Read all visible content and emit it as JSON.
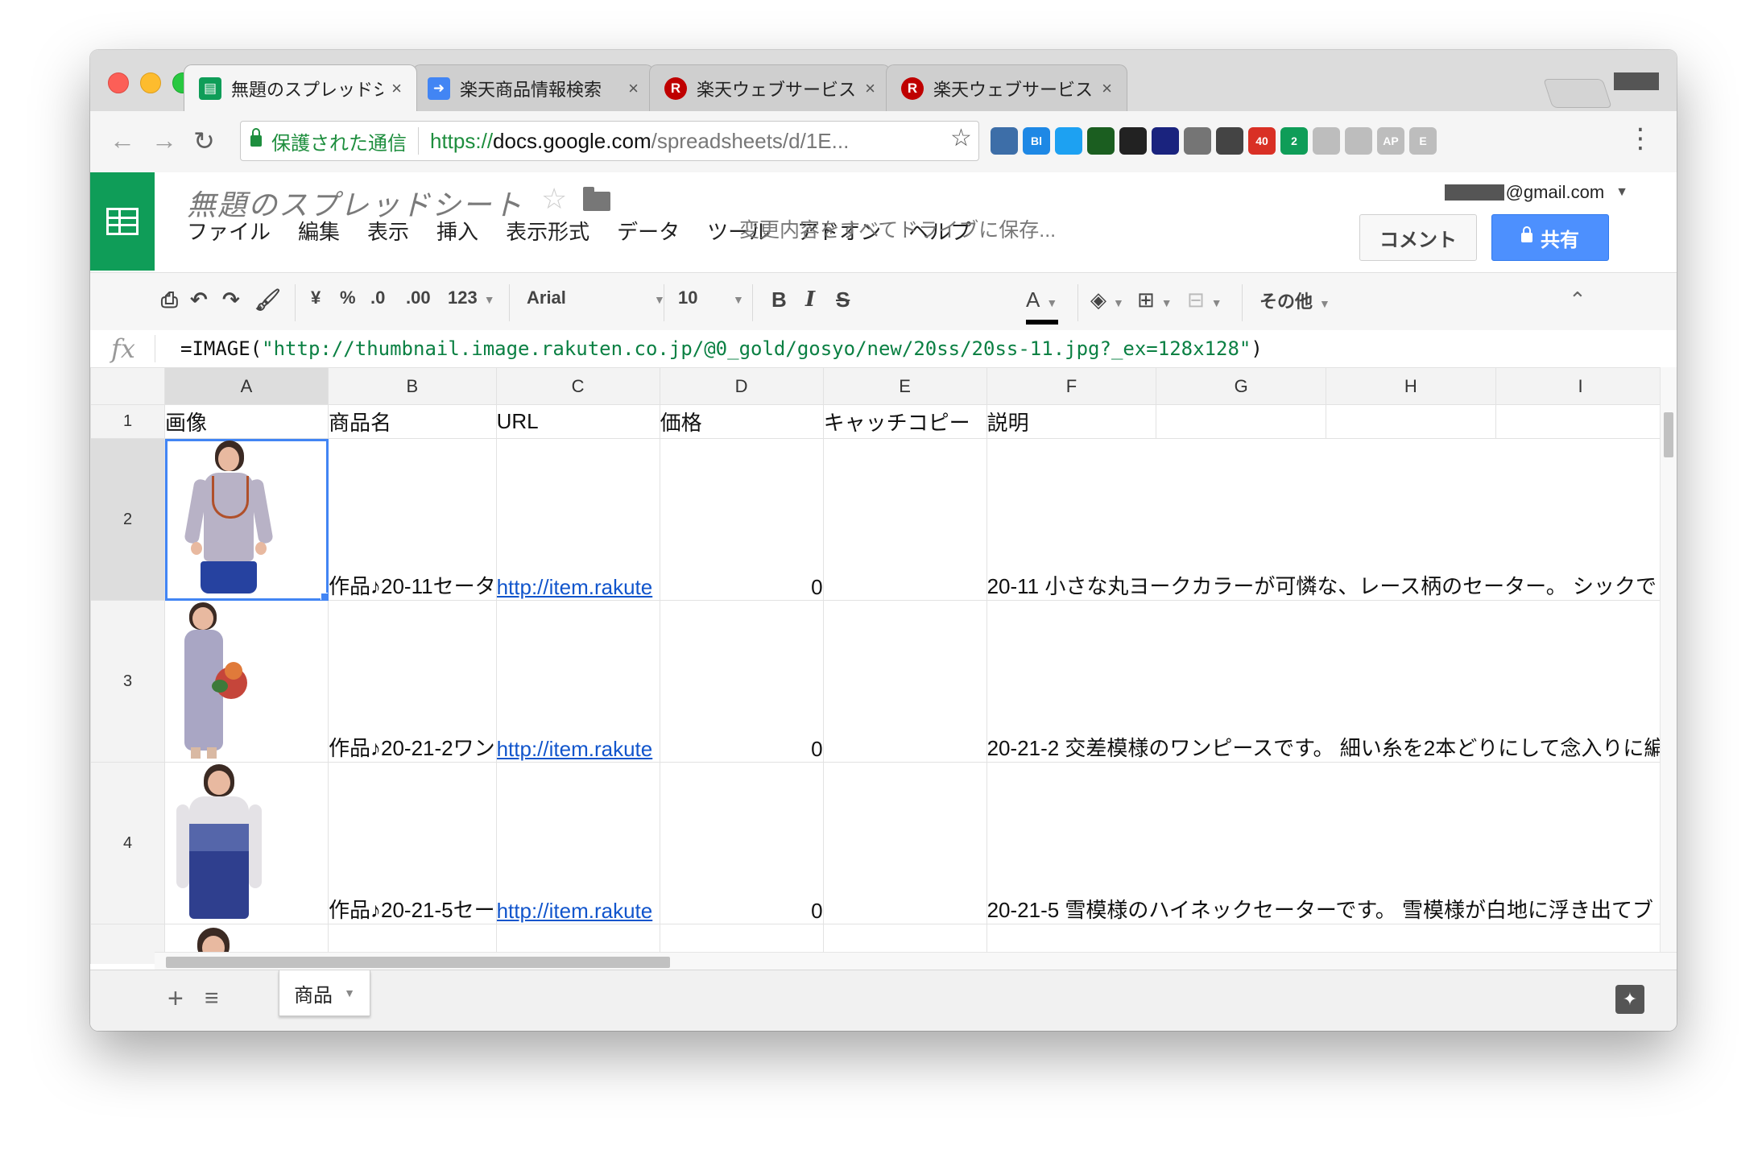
{
  "browser": {
    "tabs": [
      {
        "title": "無題のスプレッドシート - Go",
        "favicon": "sheets-icon",
        "active": true
      },
      {
        "title": "楽天商品情報検索",
        "favicon": "arrow-icon",
        "active": false
      },
      {
        "title": "楽天ウェブサービス(RAKUTE",
        "favicon": "rakuten-icon",
        "active": false
      },
      {
        "title": "楽天ウェブサービス: 楽天商品",
        "favicon": "rakuten-icon",
        "active": false
      }
    ],
    "close_glyph": "×",
    "address": {
      "secure_label": "保護された通信",
      "scheme": "https://",
      "host": "docs.google.com",
      "path": "/spreadsheets/d/1E..."
    },
    "extensions": [
      {
        "name": "gear-extension-icon",
        "color": "#3d6ea8"
      },
      {
        "name": "bl-extension-icon",
        "color": "#1e88e5",
        "label": "Bl"
      },
      {
        "name": "twitter-extension-icon",
        "color": "#1da1f2"
      },
      {
        "name": "pen-extension-icon",
        "color": "#1b5e20"
      },
      {
        "name": "camera-extension-icon",
        "color": "#222222"
      },
      {
        "name": "chart-extension-icon",
        "color": "#1a237e"
      },
      {
        "name": "mail-extension-icon",
        "color": "#757575"
      },
      {
        "name": "sync-extension-icon",
        "color": "#444444"
      },
      {
        "name": "gmail-extension-icon",
        "color": "#d93025",
        "label": "40"
      },
      {
        "name": "hangouts-extension-icon",
        "color": "#0f9d58",
        "label": "2"
      },
      {
        "name": "rss-extension-icon",
        "color": "#bdbdbd"
      },
      {
        "name": "puzzle-extension-icon",
        "color": "#bdbdbd"
      },
      {
        "name": "ap-extension-icon",
        "color": "#bdbdbd",
        "label": "AP"
      },
      {
        "name": "e-extension-icon",
        "color": "#bdbdbd",
        "label": "E"
      }
    ]
  },
  "sheets": {
    "title": "無題のスプレッドシート",
    "menu": [
      "ファイル",
      "編集",
      "表示",
      "挿入",
      "表示形式",
      "データ",
      "ツール",
      "アドオン",
      "ヘルプ"
    ],
    "save_status": "変更内容をすべてドライブに保存...",
    "account": "@gmail.com",
    "comment_label": "コメント",
    "share_label": "共有",
    "toolbar": {
      "currency": "¥",
      "percent": "%",
      "dec_decrease": ".0",
      "dec_increase": ".00",
      "number_format": "123",
      "font": "Arial",
      "font_size": "10",
      "bold": "B",
      "italic": "I",
      "strike": "S",
      "text_color": "A",
      "more": "その他"
    },
    "formula": {
      "prefix": "=IMAGE(",
      "string": "\"http://thumbnail.image.rakuten.co.jp/@0_gold/gosyo/new/20ss/20ss-11.jpg?_ex=128x128\"",
      "suffix": ")"
    },
    "columns": [
      "A",
      "B",
      "C",
      "D",
      "E",
      "F",
      "G",
      "H",
      "I"
    ],
    "header_row": {
      "row": "1",
      "cells": [
        "画像",
        "商品名",
        "URL",
        "価格",
        "キャッチコピー",
        "説明",
        "",
        "",
        ""
      ]
    },
    "rows": [
      {
        "row": "2",
        "name": "作品♪20-11セータ",
        "url": "http://item.rakute",
        "price": "0",
        "copy": "",
        "desc": "20-11 小さな丸ヨークカラーが可憐な、レース柄のセーター。 シックで"
      },
      {
        "row": "3",
        "name": "作品♪20-21-2ワン",
        "url": "http://item.rakute",
        "price": "0",
        "copy": "",
        "desc": "20-21-2 交差模様のワンピースです。 細い糸を2本どりにして念入りに編"
      },
      {
        "row": "4",
        "name": "作品♪20-21-5セー",
        "url": "http://item.rakute",
        "price": "0",
        "copy": "",
        "desc": "20-21-5 雪模様のハイネックセーターです。 雪模様が白地に浮き出てブ"
      }
    ],
    "sheet_tab": "商品",
    "selection_color": "#4285f4"
  }
}
